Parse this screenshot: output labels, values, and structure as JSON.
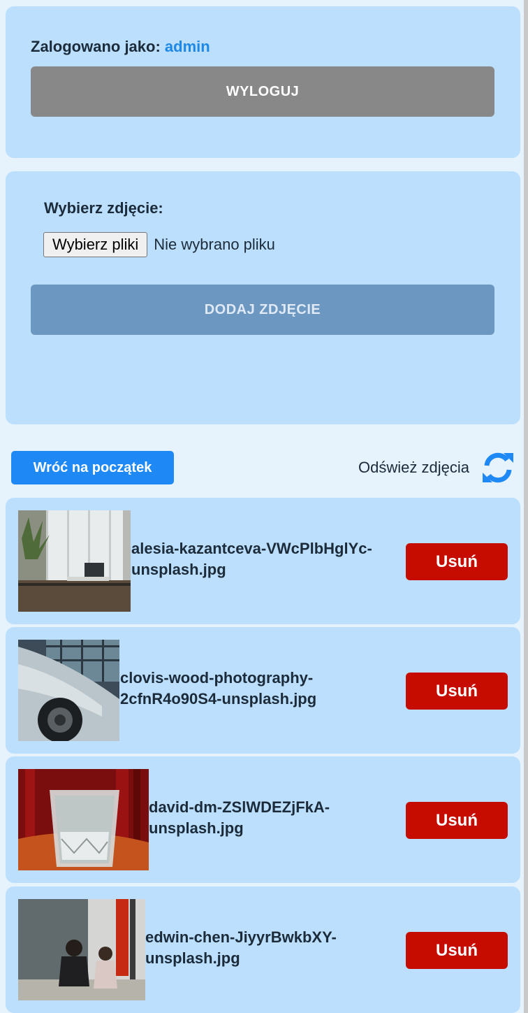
{
  "session": {
    "logged_in_label": "Zalogowano jako:",
    "username": "admin",
    "logout_label": "WYLOGUJ"
  },
  "upload": {
    "choose_label": "Wybierz zdjęcie:",
    "file_button": "Wybierz pliki",
    "file_status": "Nie wybrano pliku",
    "add_label": "DODAJ ZDJĘCIE"
  },
  "toolbar": {
    "back_label": "Wróć na początek",
    "refresh_label": "Odśwież zdjęcia",
    "refresh_icon": "refresh-icon"
  },
  "photos": [
    {
      "line1": "alesia-kazantceva-VWcPlbHglYc-",
      "line2": "unsplash.jpg",
      "delete_label": "Usuń"
    },
    {
      "line1": "clovis-wood-photography-",
      "line2": "2cfnR4o90S4-unsplash.jpg",
      "delete_label": "Usuń"
    },
    {
      "line1": "david-dm-ZSlWDEZjFkA-",
      "line2": "unsplash.jpg",
      "delete_label": "Usuń"
    },
    {
      "line1": "edwin-chen-JiyyrBwkbXY-",
      "line2": "unsplash.jpg",
      "delete_label": "Usuń"
    }
  ],
  "colors": {
    "page_bg": "#e6f3fd",
    "card_bg": "#bcdffd",
    "accent": "#1e88f5",
    "danger": "#c60b00"
  }
}
